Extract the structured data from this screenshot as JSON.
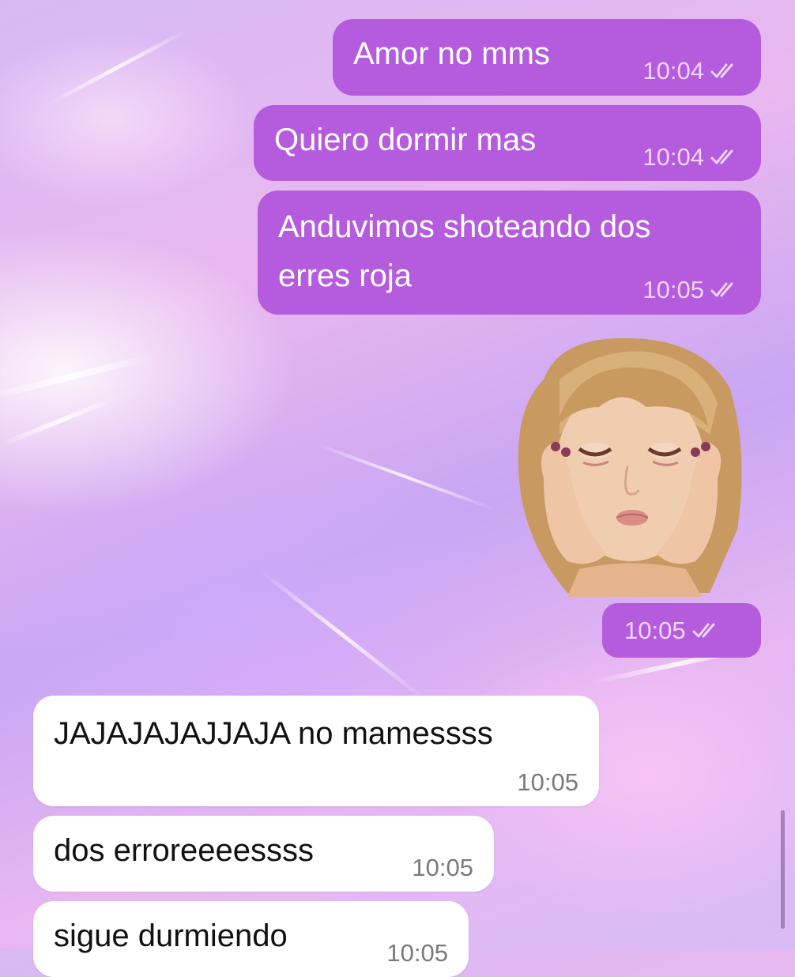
{
  "colors": {
    "outgoing_bubble": "#b45cdd",
    "incoming_bubble": "#ffffff",
    "read_check": "#f0d6ff"
  },
  "messages": [
    {
      "direction": "outgoing",
      "lines": [
        "Amor no mms"
      ],
      "time": "10:04",
      "status_icon": "double-check-icon"
    },
    {
      "direction": "outgoing",
      "lines": [
        "Quiero dormir mas"
      ],
      "time": "10:04",
      "status_icon": "double-check-icon"
    },
    {
      "direction": "outgoing",
      "lines": [
        "Anduvimos shoteando dos",
        "erres roja"
      ],
      "time": "10:05",
      "status_icon": "double-check-icon"
    },
    {
      "direction": "outgoing",
      "type": "sticker",
      "sticker": "tired-child-face",
      "time": "10:05",
      "status_icon": "double-check-icon"
    },
    {
      "direction": "incoming",
      "lines": [
        "JAJAJAJAJJAJA no mamessss"
      ],
      "time": "10:05"
    },
    {
      "direction": "incoming",
      "lines": [
        "dos erroreeeessss"
      ],
      "time": "10:05"
    },
    {
      "direction": "incoming",
      "lines": [
        "sigue durmiendo"
      ],
      "time": "10:05"
    }
  ]
}
